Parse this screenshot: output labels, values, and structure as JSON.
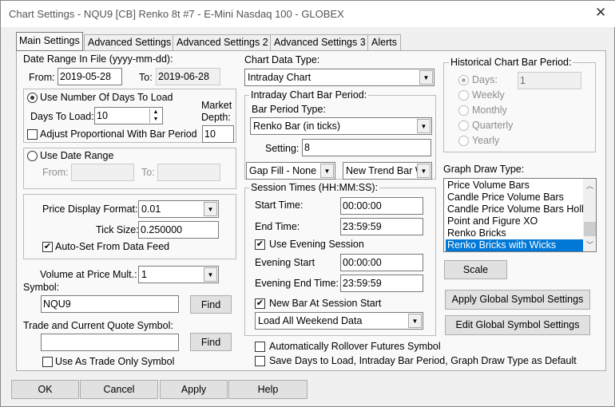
{
  "window": {
    "title": "Chart Settings - NQU9 [CB]  Renko 8t  #7 - E-Mini Nasdaq 100 - GLOBEX",
    "close": "✕"
  },
  "tabs": [
    "Main Settings",
    "Advanced Settings",
    "Advanced Settings 2",
    "Advanced Settings 3",
    "Alerts"
  ],
  "left": {
    "date_range_label": "Date Range In File (yyyy-mm-dd):",
    "from_label": "From:",
    "from_value": "2019-05-28",
    "to_label": "To:",
    "to_value": "2019-06-28",
    "use_days_label": "Use Number Of Days To Load",
    "days_label": "Days To Load:",
    "days_value": "10",
    "market_depth_label": "Market Depth:",
    "market_depth_value": "10",
    "adjust_label": "Adjust Proportional With Bar Period",
    "use_date_range_label": "Use Date Range",
    "dr_from_label": "From:",
    "dr_to_label": "To:",
    "price_format_label": "Price Display Format:",
    "price_format_value": "0.01",
    "tick_size_label": "Tick Size:",
    "tick_size_value": "0.250000",
    "auto_set_label": "Auto-Set From Data Feed",
    "vap_label": "Volume at Price Mult.:",
    "vap_value": "1",
    "symbol_label": "Symbol:",
    "symbol_value": "NQU9",
    "find": "Find",
    "trade_symbol_label": "Trade and Current Quote Symbol:",
    "trade_symbol_value": "",
    "trade_only_label": "Use As Trade Only Symbol"
  },
  "middle": {
    "chart_data_type_label": "Chart Data Type:",
    "chart_data_type_value": "Intraday Chart",
    "intraday_group": "Intraday Chart Bar Period:",
    "bar_period_type_label": "Bar Period Type:",
    "bar_period_type_value": "Renko Bar (in ticks)",
    "setting_label": "Setting:",
    "setting_value": "8",
    "gap_fill": "Gap Fill - None",
    "new_trend": "New Trend Bar W",
    "session_group": "Session Times (HH:MM:SS):",
    "start_label": "Start Time:",
    "start_value": "00:00:00",
    "end_label": "End Time:",
    "end_value": "23:59:59",
    "use_evening_label": "Use Evening Session",
    "evening_start_label": "Evening Start",
    "evening_start_value": "00:00:00",
    "evening_end_label": "Evening End Time:",
    "evening_end_value": "23:59:59",
    "new_bar_label": "New Bar At Session Start",
    "weekend_value": "Load All Weekend Data",
    "rollover_label": "Automatically Rollover Futures Symbol",
    "save_default_label": "Save Days to Load, Intraday Bar Period, Graph Draw Type as Default"
  },
  "right": {
    "historical_group": "Historical Chart Bar Period:",
    "days_label": "Days:",
    "days_value": "1",
    "weekly": "Weekly",
    "monthly": "Monthly",
    "quarterly": "Quarterly",
    "yearly": "Yearly",
    "graph_draw_label": "Graph Draw Type:",
    "graph_items": [
      "Price Volume Bars",
      "Candle Price Volume Bars",
      "Candle Price Volume Bars Hollow",
      "Point and Figure XO",
      "Renko Bricks",
      "Renko Bricks with Wicks"
    ],
    "scale": "Scale",
    "apply_global": "Apply Global Symbol Settings",
    "edit_global": "Edit Global Symbol Settings"
  },
  "buttons": {
    "ok": "OK",
    "cancel": "Cancel",
    "apply": "Apply",
    "help": "Help"
  }
}
